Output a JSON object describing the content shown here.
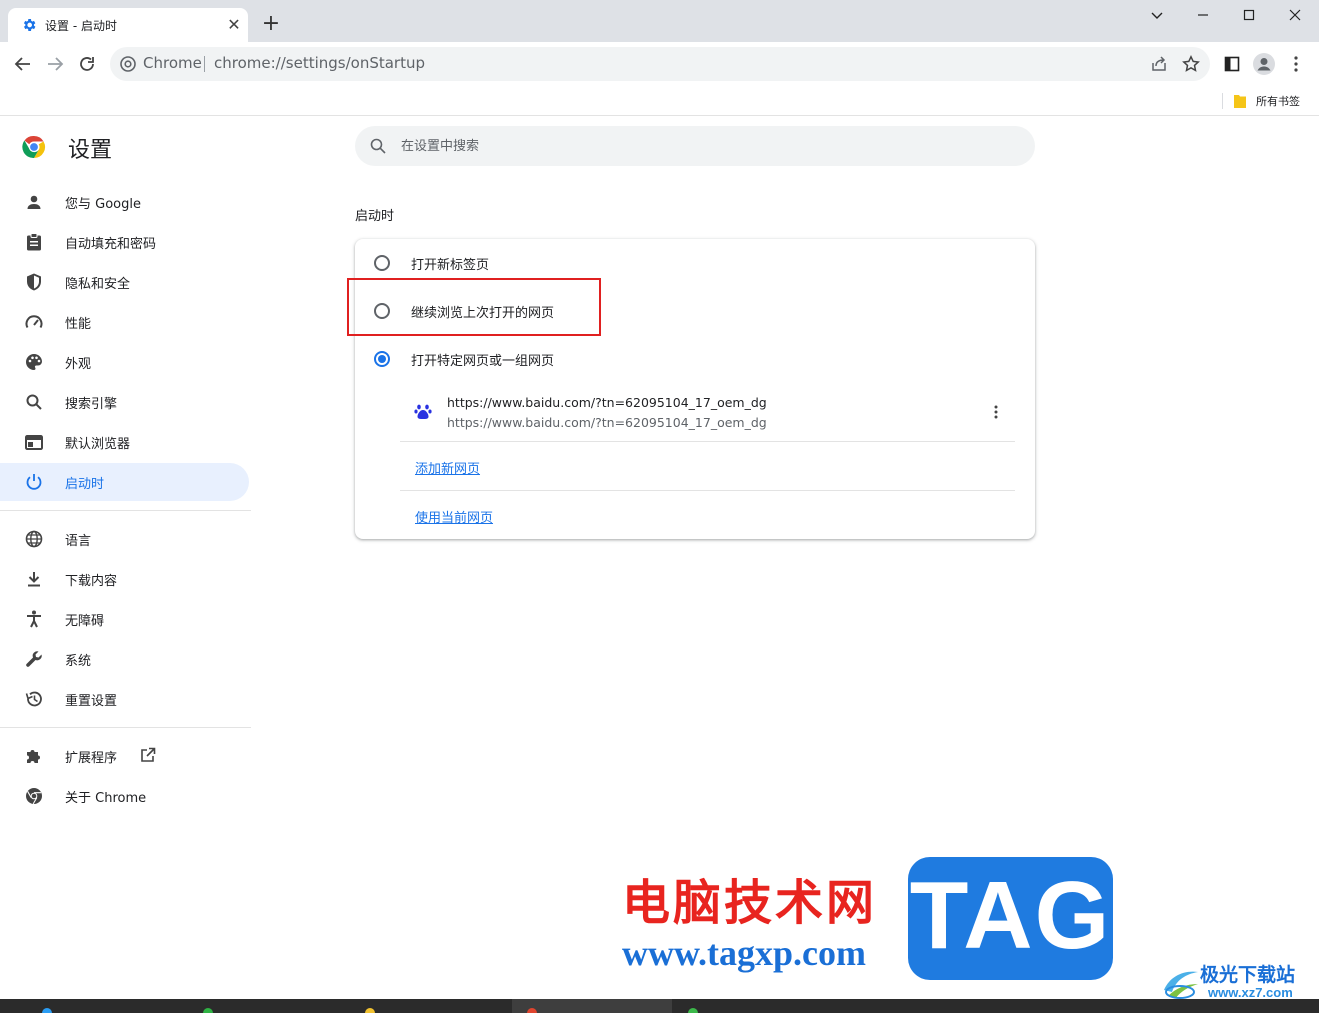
{
  "window": {
    "tab_title": "设置 - 启动时",
    "new_tab": "+",
    "close_tab": "✕"
  },
  "omnibox": {
    "site_name": "Chrome",
    "url": "chrome://settings/onStartup"
  },
  "bookmarks_bar": {
    "all_bookmarks": "所有书签"
  },
  "sidebar": {
    "title": "设置",
    "groups": [
      [
        {
          "label": "您与 Google",
          "icon": "person-icon"
        },
        {
          "label": "自动填充和密码",
          "icon": "clipboard-icon"
        },
        {
          "label": "隐私和安全",
          "icon": "shield-icon"
        },
        {
          "label": "性能",
          "icon": "speedometer-icon"
        },
        {
          "label": "外观",
          "icon": "palette-icon"
        },
        {
          "label": "搜索引擎",
          "icon": "search-icon"
        },
        {
          "label": "默认浏览器",
          "icon": "browser-icon"
        },
        {
          "label": "启动时",
          "icon": "power-icon",
          "active": true
        }
      ],
      [
        {
          "label": "语言",
          "icon": "globe-icon"
        },
        {
          "label": "下载内容",
          "icon": "download-icon"
        },
        {
          "label": "无障碍",
          "icon": "accessibility-icon"
        },
        {
          "label": "系统",
          "icon": "wrench-icon"
        },
        {
          "label": "重置设置",
          "icon": "history-icon"
        }
      ],
      [
        {
          "label": "扩展程序",
          "icon": "puzzle-icon"
        },
        {
          "label": "关于 Chrome",
          "icon": "chrome-icon"
        }
      ]
    ]
  },
  "search": {
    "placeholder": "在设置中搜索"
  },
  "startup": {
    "section_title": "启动时",
    "options": [
      {
        "label": "打开新标签页",
        "checked": false
      },
      {
        "label": "继续浏览上次打开的网页",
        "checked": false
      },
      {
        "label": "打开特定网页或一组网页",
        "checked": true
      }
    ],
    "pages": [
      {
        "title": "https://www.baidu.com/?tn=62095104_17_oem_dg",
        "url": "https://www.baidu.com/?tn=62095104_17_oem_dg"
      }
    ],
    "add_page": "添加新网页",
    "use_current": "使用当前网页"
  },
  "watermark": {
    "cn": "电脑技术网",
    "url": "www.tagxp.com",
    "tag": "TAG",
    "xz_cn": "极光下载站",
    "xz_en": "www.xz7.com"
  },
  "colors": {
    "accent": "#1a73e8",
    "active_nav_bg": "#e8f0fe",
    "highlight_box": "#e02020",
    "watermark_red": "#e8241f",
    "watermark_blue": "#1f7be0"
  }
}
